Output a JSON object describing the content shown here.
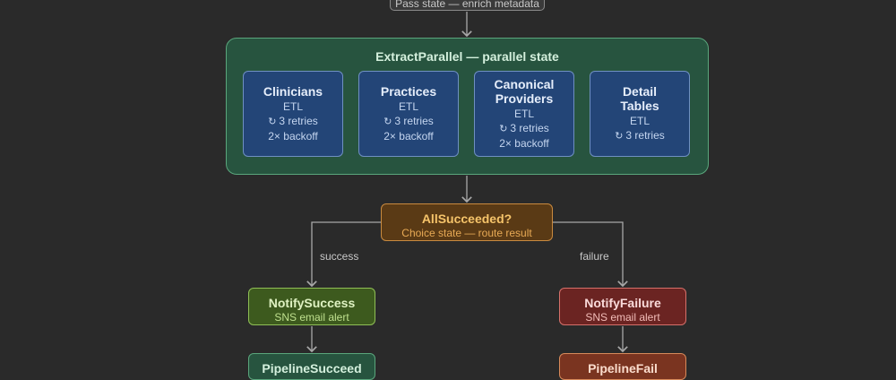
{
  "pass_state": {
    "label": "Pass state — enrich metadata"
  },
  "parallel": {
    "title": "ExtractParallel — parallel state",
    "branches": [
      {
        "name": "Clinicians",
        "type": "ETL",
        "retries": "3 retries",
        "backoff": "2× backoff"
      },
      {
        "name": "Practices",
        "type": "ETL",
        "retries": "3 retries",
        "backoff": "2× backoff"
      },
      {
        "name": "Canonical Providers",
        "type": "ETL",
        "retries": "3 retries",
        "backoff": "2× backoff"
      },
      {
        "name": "Detail Tables",
        "type": "ETL",
        "retries": "3 retries"
      }
    ]
  },
  "choice": {
    "name": "AllSucceeded?",
    "subtitle": "Choice state — route result"
  },
  "edges": {
    "success": "success",
    "failure": "failure"
  },
  "notify_success": {
    "name": "NotifySuccess",
    "subtitle": "SNS email alert"
  },
  "notify_failure": {
    "name": "NotifyFailure",
    "subtitle": "SNS email alert"
  },
  "pipeline_succeed": {
    "name": "PipelineSucceed"
  },
  "pipeline_fail": {
    "name": "PipelineFail"
  },
  "icons": {
    "retry": "retry-icon"
  },
  "colors": {
    "background": "#2a2a2a",
    "parallel_fill": "#27543f",
    "etl_fill": "#234577",
    "choice_fill": "#5a3a15",
    "success_fill": "#3d5a1e",
    "failure_fill": "#6b2422"
  }
}
